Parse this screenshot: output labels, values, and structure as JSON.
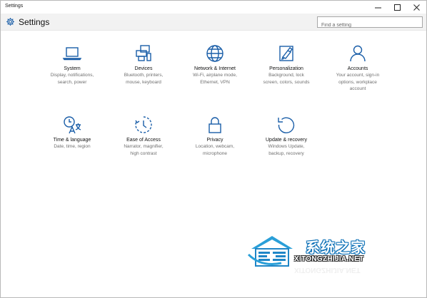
{
  "window": {
    "title": "Settings"
  },
  "header": {
    "title": "Settings"
  },
  "search": {
    "placeholder": "Find a setting"
  },
  "accent_color": "#1a5ea8",
  "categories": [
    {
      "name": "System",
      "desc1": "Display, notifications,",
      "desc2": "search, power",
      "desc3": "",
      "icon": "laptop-icon"
    },
    {
      "name": "Devices",
      "desc1": "Bluetooth, printers,",
      "desc2": "mouse, keyboard",
      "desc3": "",
      "icon": "devices-icon"
    },
    {
      "name": "Network & Internet",
      "desc1": "Wi-Fi, airplane mode,",
      "desc2": "Ethernet, VPN",
      "desc3": "",
      "icon": "globe-icon"
    },
    {
      "name": "Personalization",
      "desc1": "Background, lock",
      "desc2": "screen, colors, sounds",
      "desc3": "",
      "icon": "paintbrush-icon"
    },
    {
      "name": "Accounts",
      "desc1": "Your account, sign-in",
      "desc2": "options, workplace",
      "desc3": "account",
      "icon": "person-icon"
    },
    {
      "name": "Time & language",
      "desc1": "Date, time, region",
      "desc2": "",
      "desc3": "",
      "icon": "time-language-icon"
    },
    {
      "name": "Ease of Access",
      "desc1": "Narrator, magnifier,",
      "desc2": "high contrast",
      "desc3": "",
      "icon": "ease-of-access-icon"
    },
    {
      "name": "Privacy",
      "desc1": "Location, webcam,",
      "desc2": "microphone",
      "desc3": "",
      "icon": "lock-icon"
    },
    {
      "name": "Update & recovery",
      "desc1": "Windows Update,",
      "desc2": "backup, recovery",
      "desc3": "",
      "icon": "refresh-icon"
    }
  ],
  "watermark": {
    "chinese": "系统之家",
    "url": "XITONGZHIJIA.NET"
  }
}
